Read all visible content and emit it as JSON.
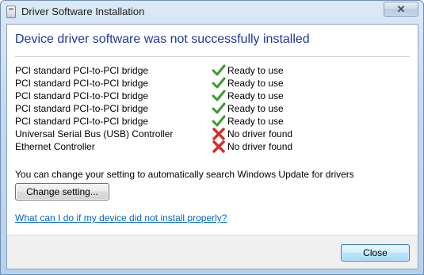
{
  "window": {
    "title": "Driver Software Installation",
    "close_glyph": "✕"
  },
  "heading": "Device driver software was not successfully installed",
  "devices": [
    {
      "name": "PCI standard PCI-to-PCI bridge",
      "status": "Ready to use",
      "icon": "check-icon"
    },
    {
      "name": "PCI standard PCI-to-PCI bridge",
      "status": "Ready to use",
      "icon": "check-icon"
    },
    {
      "name": "PCI standard PCI-to-PCI bridge",
      "status": "Ready to use",
      "icon": "check-icon"
    },
    {
      "name": "PCI standard PCI-to-PCI bridge",
      "status": "Ready to use",
      "icon": "check-icon"
    },
    {
      "name": "PCI standard PCI-to-PCI bridge",
      "status": "Ready to use",
      "icon": "check-icon"
    },
    {
      "name": "Universal Serial Bus (USB) Controller",
      "status": "No driver found",
      "icon": "error-x-icon"
    },
    {
      "name": "Ethernet Controller",
      "status": "No driver found",
      "icon": "error-x-icon"
    }
  ],
  "hint": "You can change your setting to automatically search Windows Update for drivers",
  "buttons": {
    "change_setting": "Change setting...",
    "close": "Close"
  },
  "help_link": "What can I do if my device did not install properly?",
  "colors": {
    "heading": "#1a3b9c",
    "link": "#0066cc",
    "success": "#3a9b2a",
    "error": "#d0302a"
  }
}
